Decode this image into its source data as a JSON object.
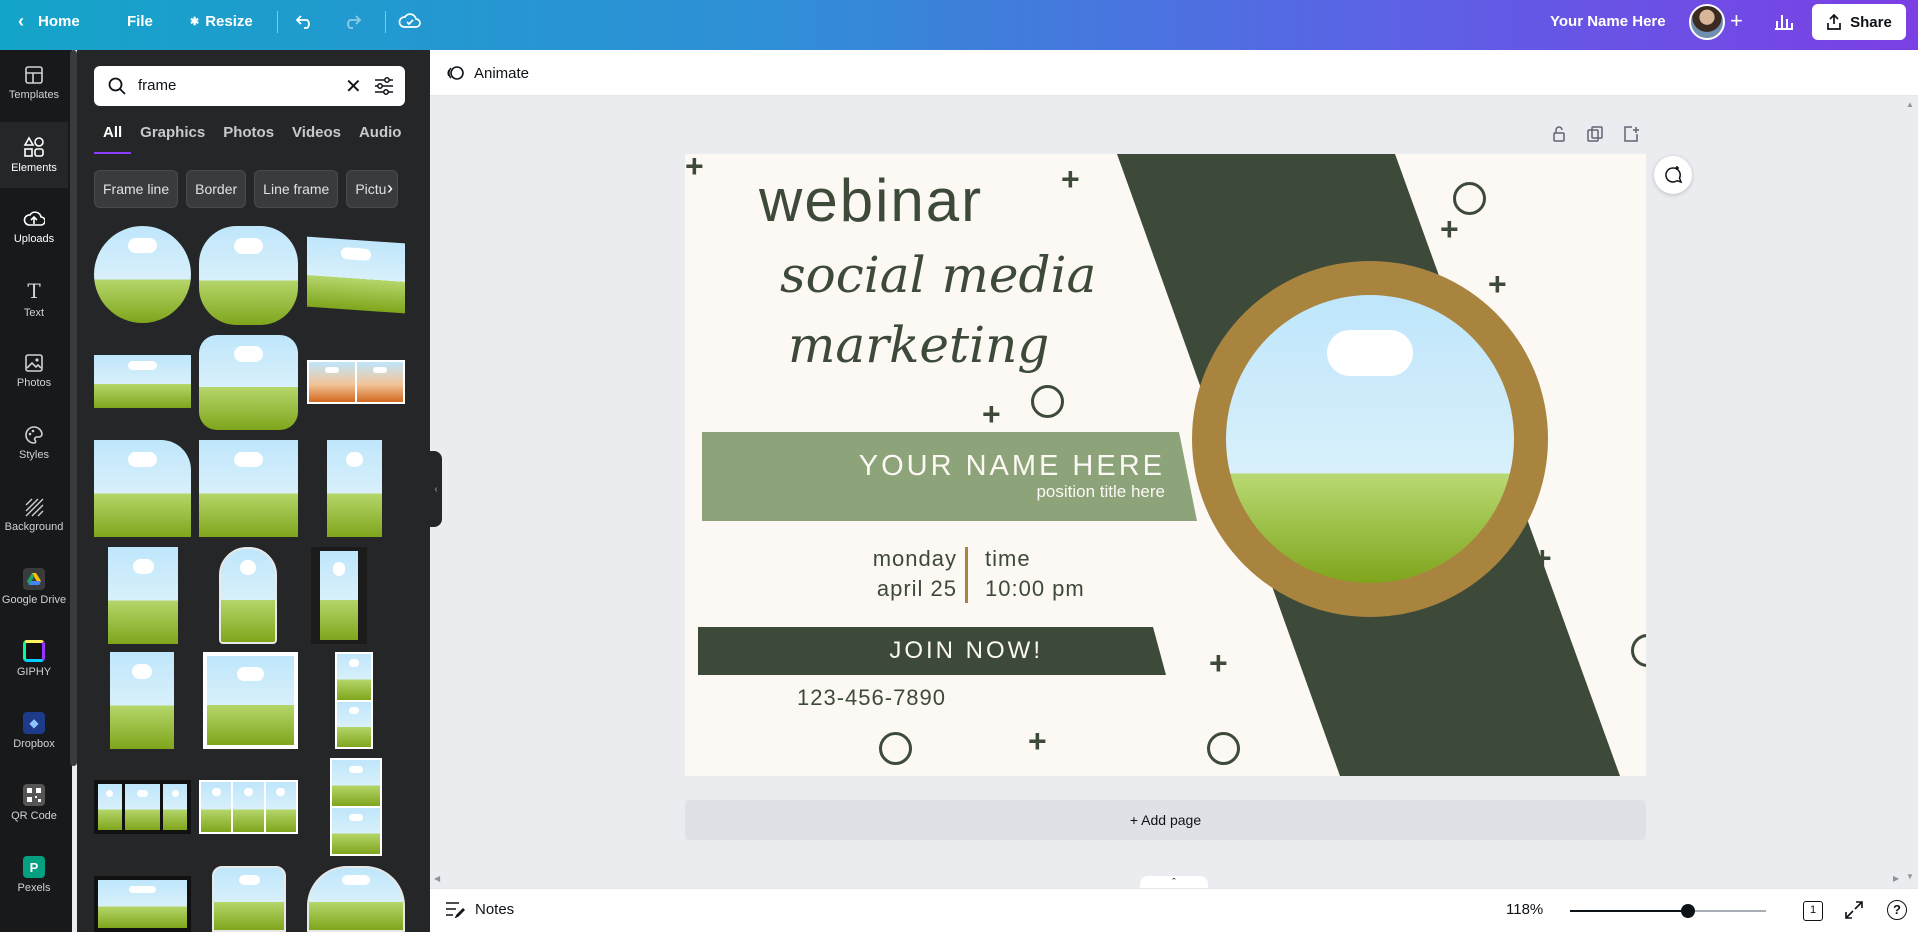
{
  "topbar": {
    "home_label": "Home",
    "file_label": "File",
    "resize_label": "Resize",
    "user_name": "Your Name Here",
    "share_label": "Share"
  },
  "rail": {
    "items": [
      {
        "label": "Templates",
        "icon": "templates-icon"
      },
      {
        "label": "Elements",
        "icon": "elements-icon"
      },
      {
        "label": "Uploads",
        "icon": "upload-icon"
      },
      {
        "label": "Text",
        "icon": "text-icon"
      },
      {
        "label": "Photos",
        "icon": "photos-icon"
      },
      {
        "label": "Styles",
        "icon": "styles-icon"
      },
      {
        "label": "Background",
        "icon": "background-icon"
      },
      {
        "label": "Google Drive",
        "icon": "google-drive-icon"
      },
      {
        "label": "GIPHY",
        "icon": "giphy-icon"
      },
      {
        "label": "Dropbox",
        "icon": "dropbox-icon"
      },
      {
        "label": "QR Code",
        "icon": "qr-code-icon"
      },
      {
        "label": "Pexels",
        "icon": "pexels-icon"
      }
    ]
  },
  "panel": {
    "search_value": "frame",
    "tabs": [
      "All",
      "Graphics",
      "Photos",
      "Videos",
      "Audio"
    ],
    "chips": [
      "Frame line",
      "Border",
      "Line frame",
      "Pictu"
    ]
  },
  "toolbar": {
    "animate_label": "Animate"
  },
  "design": {
    "title": "webinar",
    "script_line1": "social media",
    "script_line2": "marketing",
    "name": "YOUR NAME HERE",
    "position": "position title here",
    "day": "monday",
    "date": "april 25",
    "time_label": "time",
    "time_value": "10:00 pm",
    "cta": "JOIN NOW!",
    "phone": "123-456-7890"
  },
  "footer": {
    "add_page": "+ Add page",
    "notes_label": "Notes",
    "zoom": "118%",
    "zoom_fraction": 0.6,
    "page_count": "1"
  },
  "colors": {
    "dark_green": "#3d4a3a",
    "sage": "#8da37a",
    "gold": "#a8843f",
    "cream": "#fcf8f3",
    "accent": "#8b3dff"
  }
}
